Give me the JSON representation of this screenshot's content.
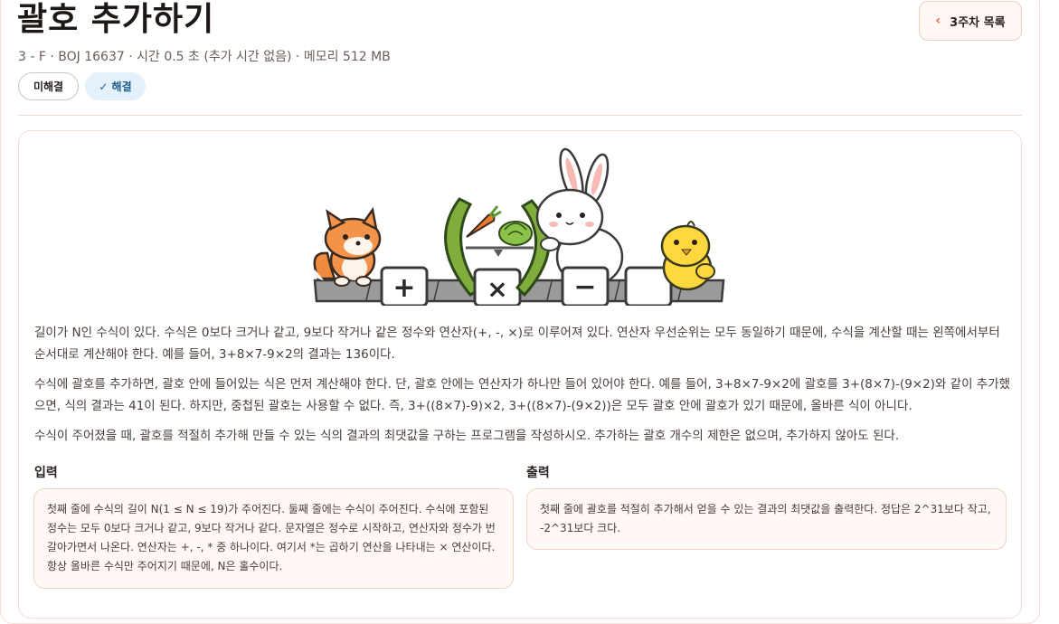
{
  "problem": {
    "title": "괄호 추가하기",
    "meta": "3 - F · BOJ 16637 · 시간 0.5 초 (추가 시간 없음) · 메모리 512 MB",
    "back_label": "3주차 목록",
    "status_unsolved": "미해결",
    "status_solved": "✓ 해결",
    "illustration": {
      "tiles": [
        "+",
        "×",
        "−",
        ""
      ],
      "icons": [
        "fox-icon",
        "carrot-icon",
        "cabbage-icon",
        "rabbit-icon",
        "chick-icon",
        "parenthesis-icon"
      ]
    },
    "paragraphs": [
      "길이가 N인 수식이 있다. 수식은 0보다 크거나 같고, 9보다 작거나 같은 정수와 연산자(+, -, ×)로 이루어져 있다. 연산자 우선순위는 모두 동일하기 때문에, 수식을 계산할 때는 왼쪽에서부터 순서대로 계산해야 한다. 예를 들어, 3+8×7-9×2의 결과는 136이다.",
      "수식에 괄호를 추가하면, 괄호 안에 들어있는 식은 먼저 계산해야 한다. 단, 괄호 안에는 연산자가 하나만 들어 있어야 한다. 예를 들어, 3+8×7-9×2에 괄호를 3+(8×7)-(9×2)와 같이 추가했으면, 식의 결과는 41이 된다. 하지만, 중첩된 괄호는 사용할 수 없다. 즉, 3+((8×7)-9)×2, 3+((8×7)-(9×2))은 모두 괄호 안에 괄호가 있기 때문에, 올바른 식이 아니다.",
      "수식이 주어졌을 때, 괄호를 적절히 추가해 만들 수 있는 식의 결과의 최댓값을 구하는 프로그램을 작성하시오. 추가하는 괄호 개수의 제한은 없으며, 추가하지 않아도 된다."
    ],
    "input_title": "입력",
    "input_text": "첫째 줄에 수식의 길이 N(1 ≤ N ≤ 19)가 주어진다. 둘째 줄에는 수식이 주어진다. 수식에 포함된 정수는 모두 0보다 크거나 같고, 9보다 작거나 같다. 문자열은 정수로 시작하고, 연산자와 정수가 번갈아가면서 나온다. 연산자는 +, -, * 중 하나이다. 여기서 *는 곱하기 연산을 나타내는 × 연산이다. 항상 올바른 수식만 주어지기 때문에, N은 홀수이다.",
    "output_title": "출력",
    "output_text": "첫째 줄에 괄호를 적절히 추가해서 얻을 수 있는 결과의 최댓값을 출력한다. 정답은 2^31보다 작고, -2^31보다 크다."
  },
  "colors": {
    "accent": "#d9623e",
    "solved_bg": "#e4f1fb",
    "solved_text": "#1f5f8b",
    "border": "#f0d3c9"
  }
}
